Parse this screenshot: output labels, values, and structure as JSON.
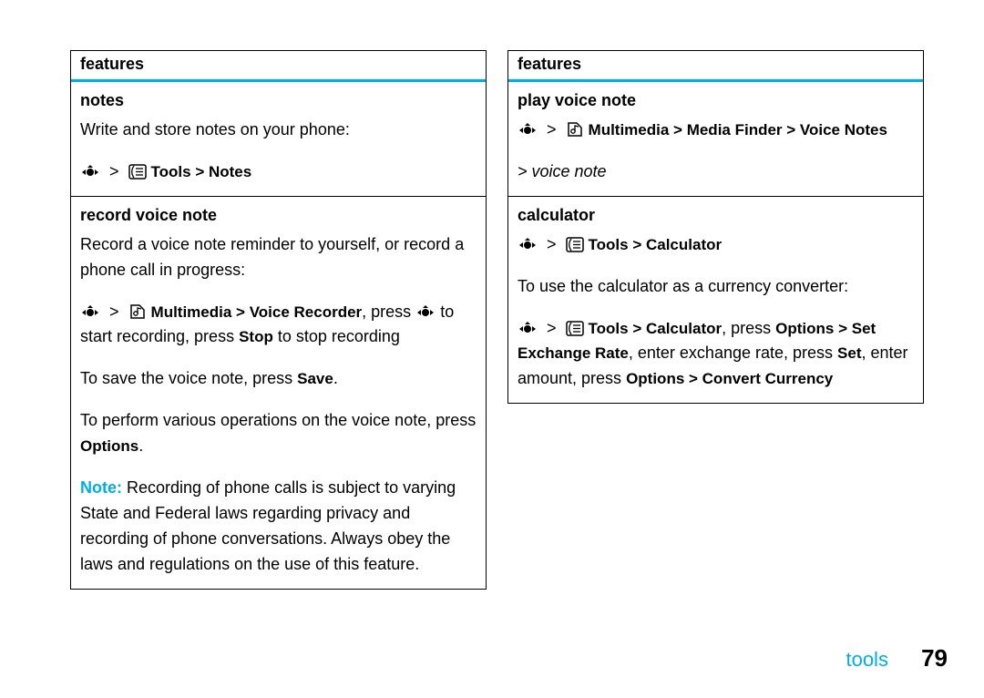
{
  "left": {
    "header": "features",
    "rows": [
      {
        "title": "notes",
        "paras": [
          {
            "t": "plain",
            "text": "Write and store notes on your phone:"
          },
          {
            "t": "nav",
            "icon2": "tools",
            "path": "Tools > Notes"
          }
        ]
      },
      {
        "title": "record voice note",
        "paras": [
          {
            "t": "plain",
            "text": "Record a voice note reminder to yourself, or record a phone call in progress:"
          },
          {
            "t": "recstart",
            "icon2": "mm",
            "path": "Multimedia > Voice Recorder",
            "mid": ", press ",
            "key": "Stop",
            "after": " to start recording, press ",
            "after2": " to stop recording"
          },
          {
            "t": "savekey",
            "before": "To save the voice note, press ",
            "key": "Save",
            "after": "."
          },
          {
            "t": "savekey",
            "before": "To perform various operations on the voice note, press ",
            "key": "Options",
            "after": "."
          },
          {
            "t": "note",
            "lead": "Note:",
            "text": " Recording of phone calls is subject to varying State and Federal laws regarding privacy and recording of phone conversations. Always obey the laws and regulations on the use of this feature."
          }
        ]
      }
    ]
  },
  "right": {
    "header": "features",
    "rows": [
      {
        "title": "play voice note",
        "paras": [
          {
            "t": "nav",
            "icon2": "mm",
            "path": "Multimedia > Media Finder > Voice Notes"
          },
          {
            "t": "ital",
            "text": "> voice note"
          }
        ]
      },
      {
        "title": "calculator",
        "paras": [
          {
            "t": "nav",
            "icon2": "tools",
            "path": "Tools > Calculator"
          },
          {
            "t": "plain",
            "text": "To use the calculator as a currency converter:"
          },
          {
            "t": "calc",
            "icon2": "tools",
            "path": "Tools > Calculator",
            "p1": ", press ",
            "k1": "Options > Set Exchange Rate",
            "p2": ", enter exchange rate, press ",
            "k2": "Set",
            "p3": ", enter amount, press ",
            "k3": "Options > Convert Currency"
          }
        ]
      }
    ]
  },
  "footer": {
    "section": "tools",
    "page": "79"
  }
}
